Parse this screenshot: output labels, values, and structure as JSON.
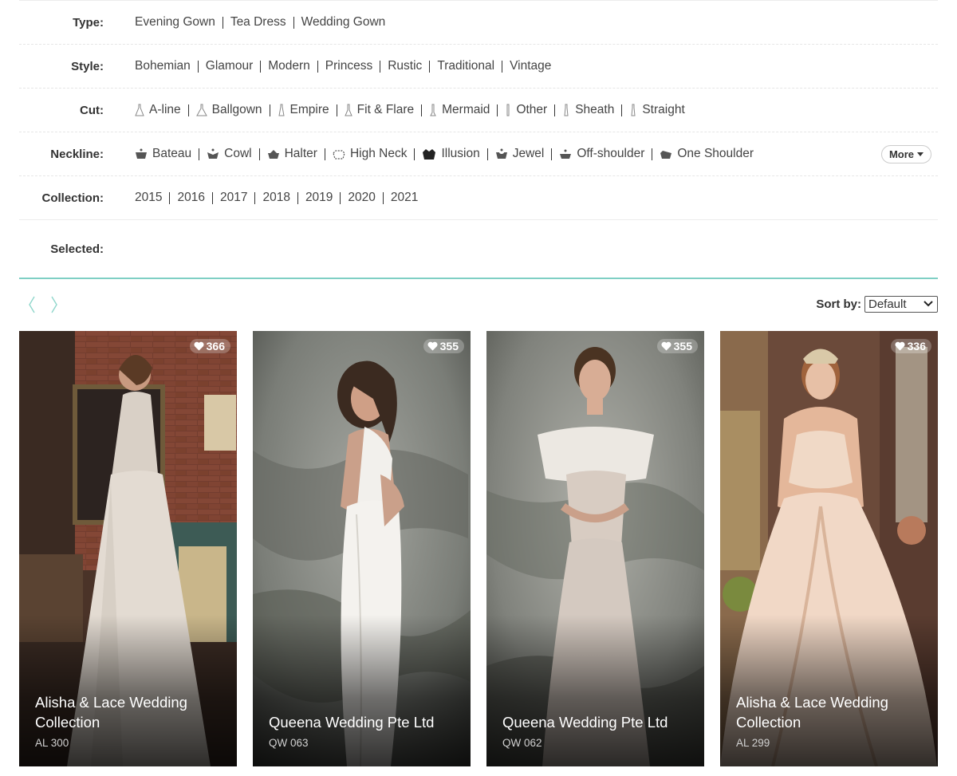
{
  "filters": {
    "type": {
      "label": "Type:",
      "options": [
        "Evening Gown",
        "Tea Dress",
        "Wedding Gown"
      ]
    },
    "style": {
      "label": "Style:",
      "options": [
        "Bohemian",
        "Glamour",
        "Modern",
        "Princess",
        "Rustic",
        "Traditional",
        "Vintage"
      ]
    },
    "cut": {
      "label": "Cut:",
      "options": [
        "A-line",
        "Ballgown",
        "Empire",
        "Fit & Flare",
        "Mermaid",
        "Other",
        "Sheath",
        "Straight"
      ]
    },
    "neckline": {
      "label": "Neckline:",
      "options": [
        "Bateau",
        "Cowl",
        "Halter",
        "High Neck",
        "Illusion",
        "Jewel",
        "Off-shoulder",
        "One Shoulder"
      ],
      "more_label": "More"
    },
    "collection": {
      "label": "Collection:",
      "options": [
        "2015",
        "2016",
        "2017",
        "2018",
        "2019",
        "2020",
        "2021"
      ]
    },
    "selected_label": "Selected:"
  },
  "sort": {
    "label": "Sort by:",
    "value": "Default"
  },
  "cards": [
    {
      "likes": "366",
      "title_line1": "Alisha & Lace Wedding",
      "title_line2": "Collection",
      "code": "AL 300"
    },
    {
      "likes": "355",
      "title_line1": "Queena Wedding Pte Ltd",
      "title_line2": "",
      "code": "QW 063"
    },
    {
      "likes": "355",
      "title_line1": "Queena Wedding Pte Ltd",
      "title_line2": "",
      "code": "QW 062"
    },
    {
      "likes": "336",
      "title_line1": "Alisha & Lace Wedding",
      "title_line2": "Collection",
      "code": "AL 299"
    }
  ],
  "colors": {
    "accent": "#7fcfc4",
    "text": "#333333"
  }
}
